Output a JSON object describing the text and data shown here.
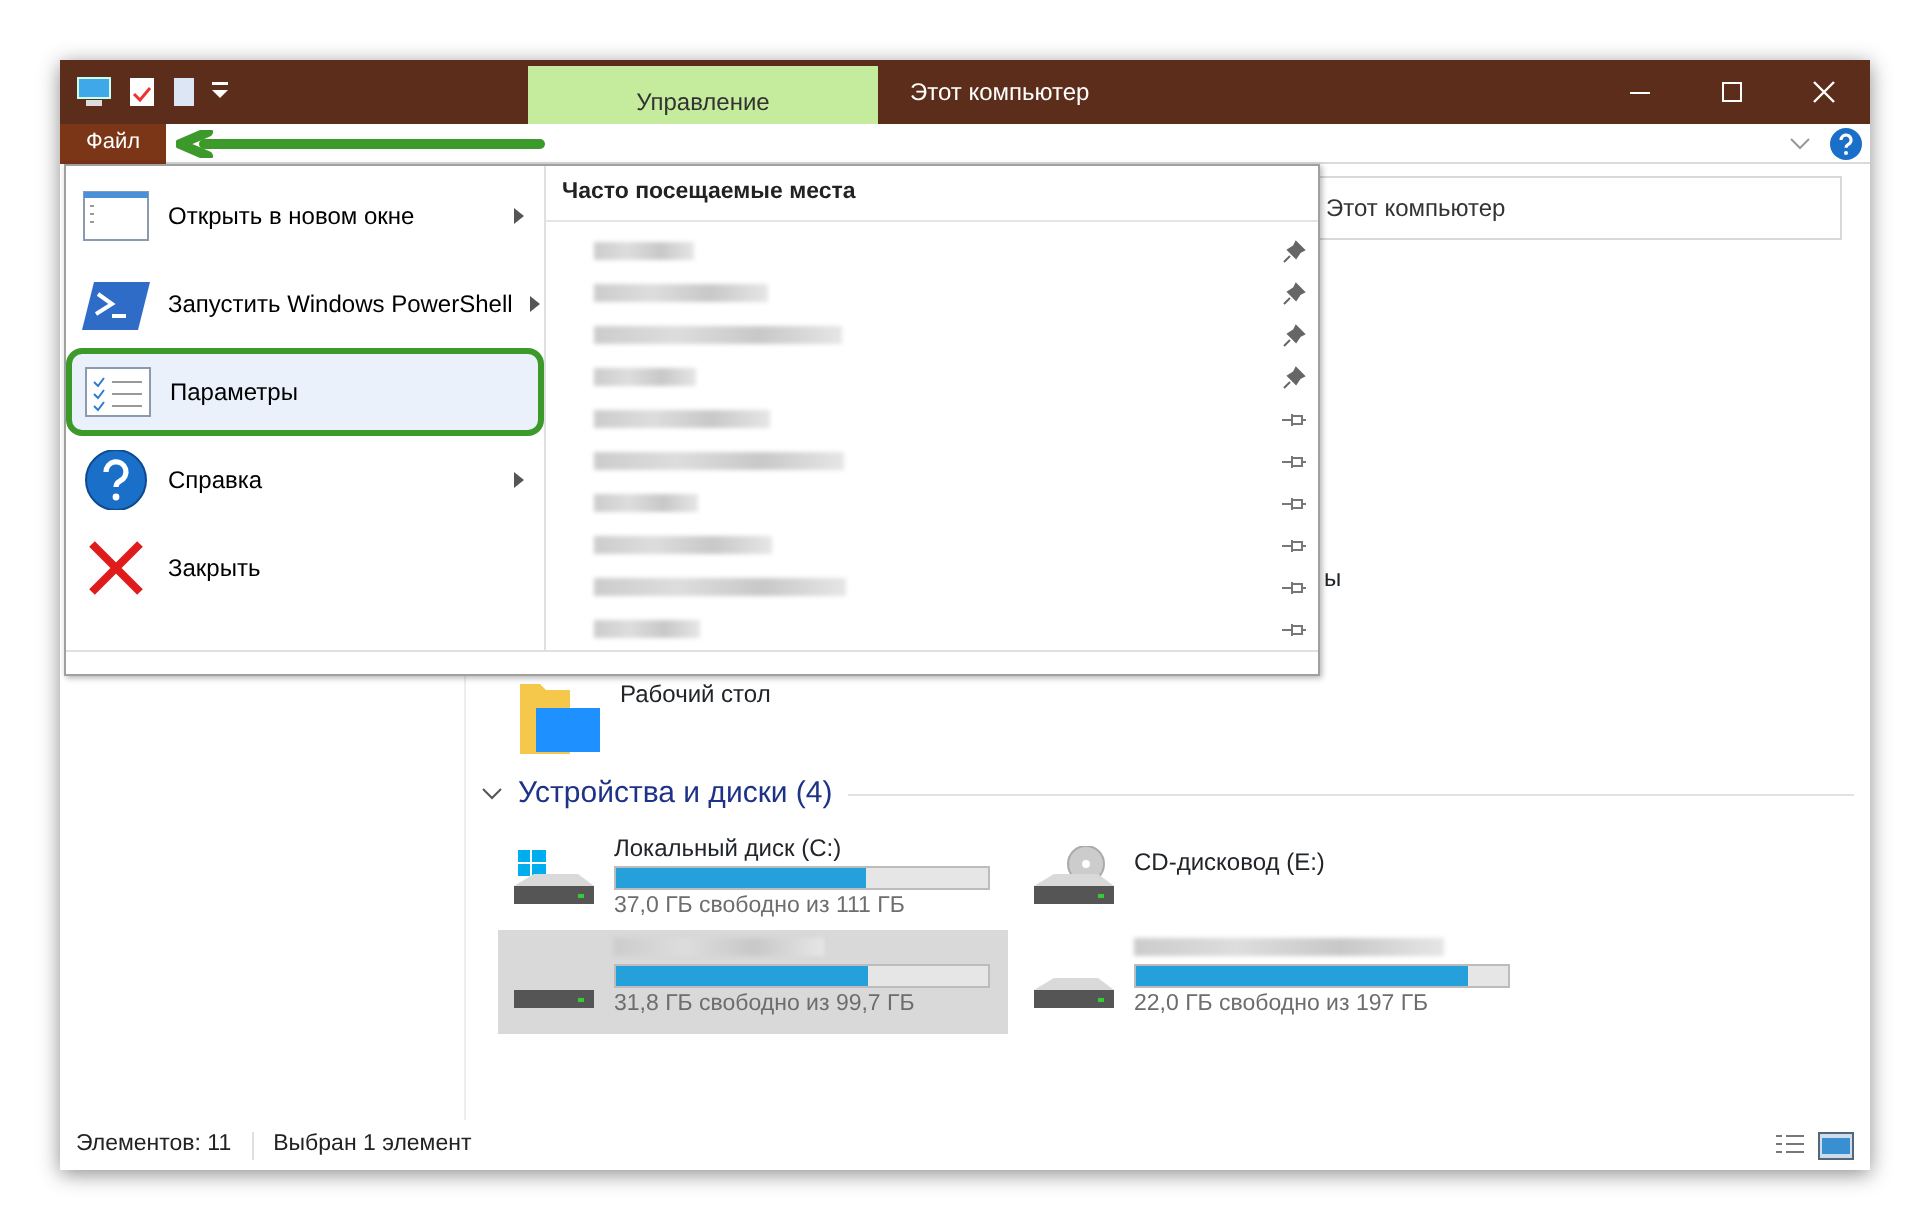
{
  "window": {
    "title": "Этот компьютер",
    "context_tab": "Управление"
  },
  "ribbon": {
    "file_tab": "Файл"
  },
  "address_bar": {
    "value": "Этот компьютер"
  },
  "file_menu": {
    "items": [
      {
        "kind": "new-window",
        "label": "Открыть в новом окне",
        "submenu": true,
        "selected": false
      },
      {
        "kind": "powershell",
        "label": "Запустить Windows PowerShell",
        "submenu": true,
        "selected": false
      },
      {
        "kind": "options",
        "label": "Параметры",
        "submenu": false,
        "selected": true
      },
      {
        "kind": "help",
        "label": "Справка",
        "submenu": true,
        "selected": false
      },
      {
        "kind": "close",
        "label": "Закрыть",
        "submenu": false,
        "selected": false
      }
    ],
    "frequent_places": {
      "title": "Часто посещаемые места",
      "items": [
        {
          "pinned": true
        },
        {
          "pinned": true
        },
        {
          "pinned": true
        },
        {
          "pinned": true
        },
        {
          "pinned": false
        },
        {
          "pinned": false
        },
        {
          "pinned": false
        },
        {
          "pinned": false
        },
        {
          "pinned": false
        },
        {
          "pinned": false
        }
      ]
    }
  },
  "content": {
    "cut_label": "ы",
    "folder": {
      "name": "Рабочий стол"
    },
    "devices": {
      "title": "Устройства и диски (4)",
      "items": [
        {
          "kind": "system-disk",
          "name": "Локальный диск (C:)",
          "level": 0.67,
          "free": "37,0 ГБ свободно из 111 ГБ",
          "selected": false
        },
        {
          "kind": "cd",
          "name": "CD-дисковод (E:)",
          "selected": false
        },
        {
          "kind": "disk",
          "level": 0.68,
          "free": "31,8 ГБ свободно из 99,7 ГБ",
          "selected": true
        },
        {
          "kind": "disk",
          "level": 0.89,
          "free": "22,0 ГБ свободно из 197 ГБ",
          "selected": false
        }
      ]
    }
  },
  "status_bar": {
    "items_count": "Элементов: 11",
    "selection": "Выбран 1 элемент"
  }
}
